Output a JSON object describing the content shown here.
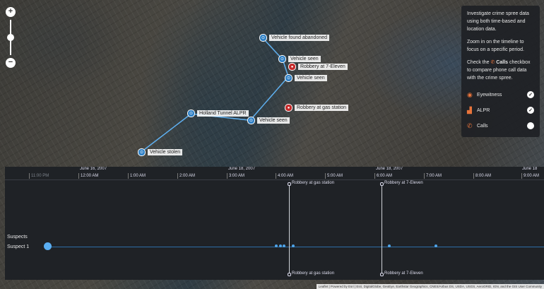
{
  "map": {
    "zoom": {
      "in_label": "+",
      "out_label": "−",
      "level": 0.5
    },
    "markers": [
      {
        "label": "Vehicle stolen",
        "kind": "blue",
        "glyph": "⊙"
      },
      {
        "label": "Holland Tunnel ALPR",
        "kind": "blue",
        "glyph": "⊙"
      },
      {
        "label": "Vehicle seen",
        "kind": "blue",
        "glyph": "⊙"
      },
      {
        "label": "Vehicle seen",
        "kind": "blue",
        "glyph": "⊙"
      },
      {
        "label": "Vehicle found abandoned",
        "kind": "blue",
        "glyph": "⊙"
      },
      {
        "label": "Vehicle seen",
        "kind": "blue",
        "glyph": "⊙"
      },
      {
        "label": "Robbery at 7-Eleven",
        "kind": "red",
        "glyph": "●"
      },
      {
        "label": "Robbery at gas station",
        "kind": "red",
        "glyph": "●"
      }
    ]
  },
  "panel": {
    "intro": "Investigate crime spree data using both time-based and location data.",
    "zoom_hint": "Zoom in on the timeline to focus on a specific period.",
    "check_prefix": "Check the",
    "calls_word": "Calls",
    "check_suffix": "checkbox to compare phone call data with the crime spree.",
    "rows": [
      {
        "label": "Eyewitness",
        "icon": "eye-icon",
        "glyph": "◉",
        "checked": true,
        "mark": "✓"
      },
      {
        "label": "ALPR",
        "icon": "car-icon",
        "glyph": "▟",
        "checked": true,
        "mark": "✓"
      },
      {
        "label": "Calls",
        "icon": "phone-icon",
        "glyph": "✆",
        "checked": false,
        "mark": ""
      }
    ]
  },
  "timeline": {
    "dates": [
      "June 16, 2007",
      "June 18, 2007",
      "June 18, 2007",
      "June 18"
    ],
    "ticks": [
      "11:00 PM",
      "12:00 AM",
      "1:00 AM",
      "2:00 AM",
      "3:00 AM",
      "4:00 AM",
      "5:00 AM",
      "6:00 AM",
      "7:00 AM",
      "8:00 AM",
      "9:00 AM"
    ],
    "group_label": "Suspects",
    "row_label": "Suspect 1",
    "events": [
      {
        "top": "Robbery at gas station",
        "bottom": "Robbery at gas station"
      },
      {
        "top": "Robbery at 7-Eleven",
        "bottom": "Robbery at 7-Eleven"
      }
    ]
  },
  "attribution": "Leaflet | Powered by Esri | Esri, DigitalGlobe, GeoEye, Earthstar Geographics, CNES/Airbus DS, USDA, USGS, AeroGRID, IGN, and the GIS User Community"
}
